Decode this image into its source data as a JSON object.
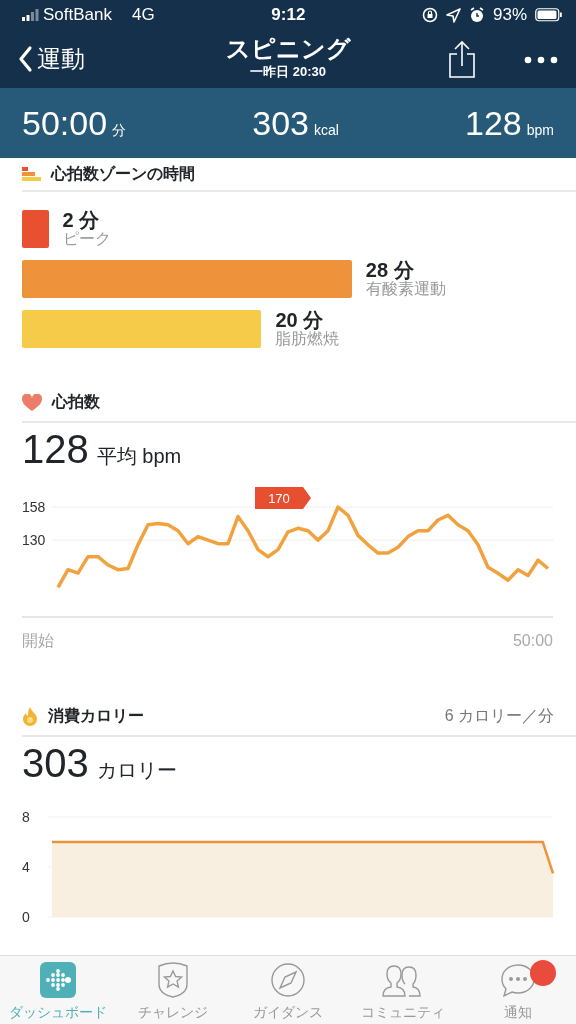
{
  "status_bar": {
    "carrier": "SoftBank",
    "network": "4G",
    "time": "9:12",
    "battery": "93%"
  },
  "nav": {
    "back_label": "運動",
    "title": "スピニング",
    "subtitle": "一昨日 20:30"
  },
  "summary": [
    {
      "value": "50:00",
      "unit": "分"
    },
    {
      "value": "303",
      "unit": "kcal"
    },
    {
      "value": "128",
      "unit": "bpm"
    }
  ],
  "zones": {
    "title": "心拍数ゾーンの時間",
    "items": [
      {
        "minutes": "2 分",
        "label": "ピーク",
        "color": "#e94f31"
      },
      {
        "minutes": "28 分",
        "label": "有酸素運動",
        "color": "#ee923c"
      },
      {
        "minutes": "20 分",
        "label": "脂肪燃焼",
        "color": "#f6cb4a"
      }
    ]
  },
  "heart_rate": {
    "title": "心拍数",
    "value": "128",
    "unit": "平均 bpm",
    "start_label": "開始",
    "end_label": "50:00",
    "chart_data": {
      "type": "line",
      "categories": [
        null,
        null,
        null,
        null,
        null,
        null,
        null,
        null,
        null,
        null,
        null,
        null,
        null,
        null,
        null,
        null,
        null,
        null,
        null,
        null,
        null,
        null,
        null,
        null,
        null,
        null,
        null,
        null,
        null,
        null,
        null,
        null,
        null,
        null,
        null,
        null,
        null,
        null,
        null,
        null,
        null,
        null,
        null,
        null,
        null,
        null,
        null,
        null,
        null,
        null
      ],
      "series": [
        {
          "color": "#f1a23e",
          "values": [
            90,
            105,
            102,
            116,
            116,
            109,
            105,
            106,
            126,
            143,
            144,
            143,
            138,
            127,
            133,
            130,
            127,
            127,
            150,
            138,
            122,
            116,
            122,
            137,
            140,
            138,
            130,
            138,
            158,
            151,
            134,
            126,
            119,
            119,
            124,
            133,
            138,
            138,
            147,
            151,
            143,
            138,
            126,
            107,
            102,
            96,
            105,
            100,
            113,
            106
          ]
        }
      ],
      "ylim": [
        65,
        158
      ],
      "yticks": [
        130,
        158
      ],
      "annotations": [
        "170"
      ]
    }
  },
  "calories": {
    "title": "消費カロリー",
    "rate": "6 カロリー／分",
    "value": "303",
    "unit": "カロリー",
    "chart_data": {
      "type": "area",
      "series": [
        {
          "values": [
            6,
            6,
            6,
            6,
            6,
            6,
            6,
            6,
            6,
            6,
            6,
            6,
            6,
            6,
            6,
            6,
            6,
            6,
            6,
            6,
            6,
            6,
            6,
            6,
            6,
            6,
            6,
            6,
            6,
            6,
            6,
            6,
            6,
            6,
            6,
            6,
            6,
            6,
            6,
            6,
            6,
            6,
            6,
            6,
            6,
            6,
            6,
            6,
            6,
            3.5
          ]
        }
      ],
      "ylim": [
        0,
        8
      ],
      "yticks": [
        0,
        4,
        8
      ]
    }
  },
  "tab_bar": [
    {
      "label": "ダッシュボード",
      "selected": true,
      "badge": false
    },
    {
      "label": "チャレンジ",
      "selected": false,
      "badge": false
    },
    {
      "label": "ガイダンス",
      "selected": false,
      "badge": false
    },
    {
      "label": "コミュニティ",
      "selected": false,
      "badge": false
    },
    {
      "label": "通知",
      "selected": false,
      "badge": true
    }
  ]
}
